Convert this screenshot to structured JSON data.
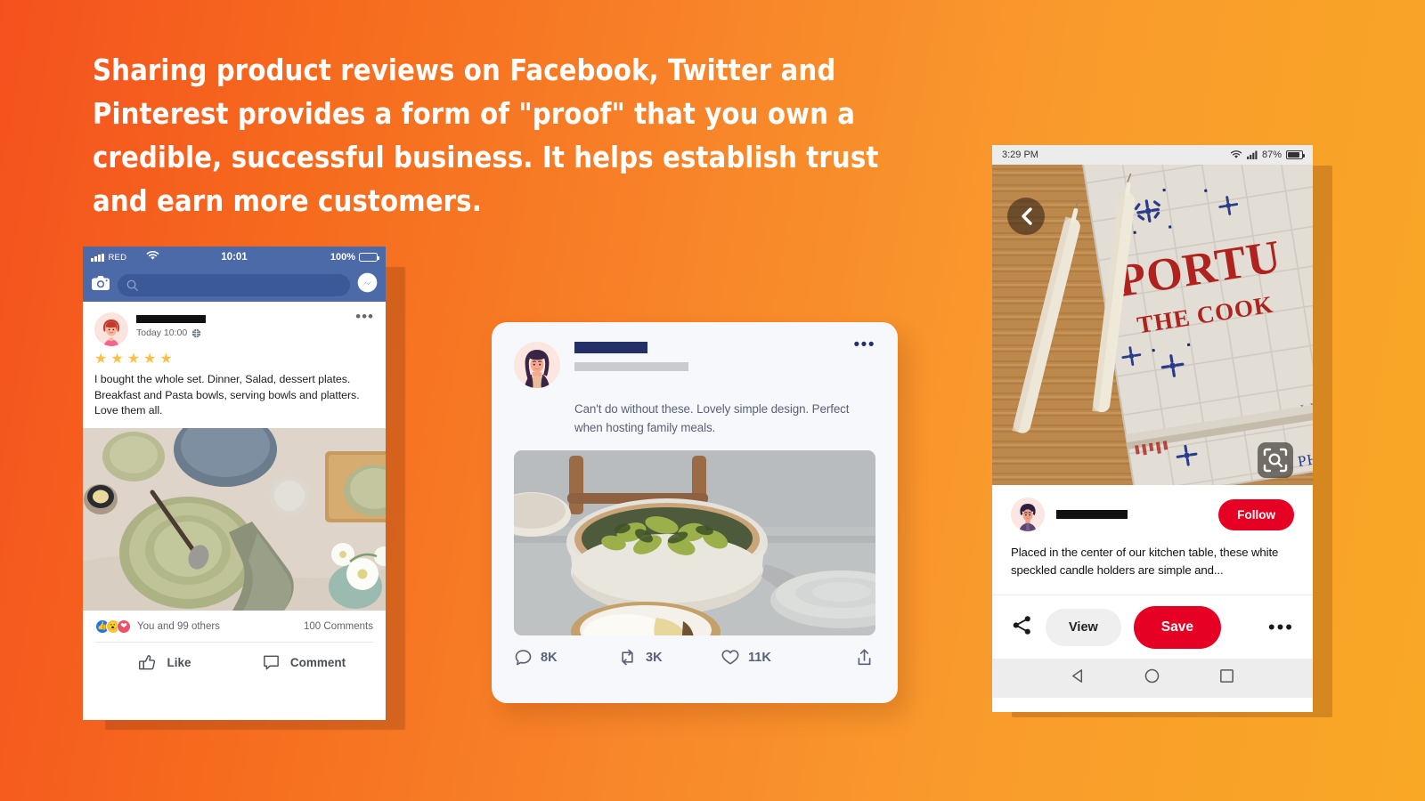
{
  "background": {
    "gradient_from": "#F4511E",
    "gradient_to": "#F9A825"
  },
  "headline": {
    "text": "Sharing product reviews on Facebook, Twitter and Pinterest provides a form of \"proof\" that you own a credible, successful business. It helps establish trust and earn more customers.",
    "color": "#FFFFFF"
  },
  "facebook": {
    "status_bar": {
      "carrier": "RED",
      "time": "10:01",
      "battery_percent": "100%",
      "signal_icon": "signal-bars-icon",
      "wifi_icon": "wifi-icon",
      "battery_icon": "battery-icon"
    },
    "nav": {
      "camera_icon": "camera-icon",
      "search_icon": "search-icon",
      "search_placeholder": "",
      "messenger_icon": "messenger-icon"
    },
    "post": {
      "author_name": "",
      "timestamp": "Today 10:00",
      "privacy_icon": "globe-icon",
      "more_icon": "more-horizontal-icon",
      "rating": 5,
      "star_color": "#FBBF45",
      "text": "I bought the whole set. Dinner, Salad, dessert plates. Breakfast and Pasta bowls, serving bowls and platters. Love them all.",
      "image_alt": "tableware-flatlay-photo"
    },
    "engagement": {
      "reactions": [
        "like",
        "wow",
        "love"
      ],
      "reaction_text": "You and 99 others",
      "comments_text": "100 Comments"
    },
    "actions": [
      {
        "label": "Like",
        "icon": "thumbs-up-icon"
      },
      {
        "label": "Comment",
        "icon": "comment-bubble-icon"
      }
    ],
    "header_color": "#4C69A8"
  },
  "twitter": {
    "card_bg": "#F6F8FC",
    "author_name": "",
    "handle": "",
    "more_icon": "more-horizontal-icon",
    "text": "Can't do without these. Lovely simple design. Perfect when hosting family meals.",
    "image_alt": "green-pasta-bowl-photo",
    "actions": [
      {
        "icon": "reply-icon",
        "count": "8K",
        "name": "reply"
      },
      {
        "icon": "retweet-icon",
        "count": "3K",
        "name": "retweet"
      },
      {
        "icon": "heart-icon",
        "count": "11K",
        "name": "like"
      },
      {
        "icon": "share-icon",
        "count": "",
        "name": "share"
      }
    ]
  },
  "pinterest": {
    "status_bar": {
      "time": "3:29 PM",
      "battery_percent": "87%",
      "wifi_icon": "wifi-icon",
      "signal_icon": "signal-bars-icon",
      "battery_icon": "battery-icon"
    },
    "image_alt": "portuguese-cookbook-candles-photo",
    "back_icon": "chevron-left-icon",
    "lens_icon": "visual-search-icon",
    "author_name": "",
    "follow_label": "Follow",
    "follow_color": "#E60023",
    "description": "Placed in the center of our kitchen table, these white speckled candle holders are simple and...",
    "actions": {
      "share_icon": "share-node-icon",
      "view_label": "View",
      "save_label": "Save",
      "save_color": "#E60023",
      "more_icon": "more-horizontal-icon"
    },
    "android_nav": [
      {
        "icon": "back-triangle-icon",
        "name": "android-back"
      },
      {
        "icon": "home-circle-icon",
        "name": "android-home"
      },
      {
        "icon": "recents-square-icon",
        "name": "android-recents"
      }
    ]
  }
}
